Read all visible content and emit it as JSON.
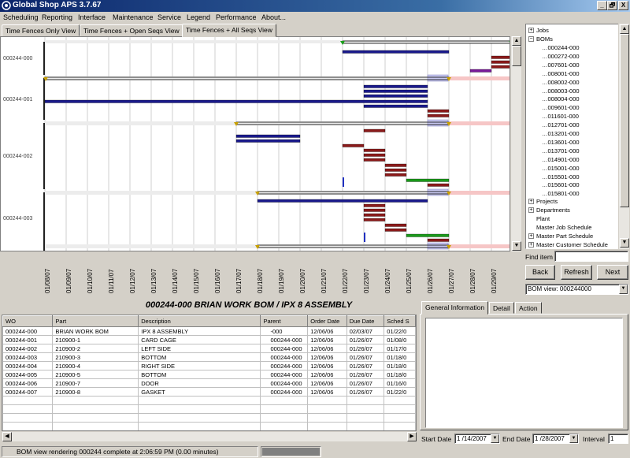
{
  "window": {
    "title": "Global Shop APS 3.7.67",
    "controls": [
      "_",
      "🗗",
      "X"
    ]
  },
  "menu": [
    "Scheduling",
    "Reporting",
    "Interface",
    "Maintenance",
    "Service",
    "Legend",
    "Performance",
    "About..."
  ],
  "tabs": [
    "Time Fences Only View",
    "Time Fences + Open Seqs View",
    "Time Fences + All Seqs View"
  ],
  "gantt": {
    "rows": [
      "000244-000",
      "000244-001",
      "000244-002",
      "000244-003"
    ],
    "dates": [
      "01/08/07",
      "01/09/07",
      "01/10/07",
      "01/11/07",
      "01/12/07",
      "01/13/07",
      "01/14/07",
      "01/15/07",
      "01/16/07",
      "01/17/07",
      "01/18/07",
      "01/19/07",
      "01/20/07",
      "01/21/07",
      "01/22/07",
      "01/23/07",
      "01/24/07",
      "01/25/07",
      "01/26/07",
      "01/27/07",
      "01/28/07",
      "01/29/07"
    ]
  },
  "tree": {
    "jobs": "Jobs",
    "boms": "BOMs",
    "bom_items": [
      "000244-000",
      "000272-000",
      "007601-000",
      "008001-000",
      "008002-000",
      "008003-000",
      "008004-000",
      "009601-000",
      "011601-000",
      "012701-000",
      "013201-000",
      "013601-000",
      "013701-000",
      "014901-000",
      "015001-000",
      "015501-000",
      "015601-000",
      "015801-000"
    ],
    "other": [
      "Projects",
      "Departments",
      "Plant",
      "Master Job Schedule",
      "Master Part Schedule",
      "Master Customer Schedule"
    ]
  },
  "find": {
    "label": "Find item",
    "value": ""
  },
  "buttons": {
    "back": "Back",
    "refresh": "Refresh",
    "next": "Next"
  },
  "bom_view": "BOM view: 000244000",
  "wo_heading": "000244-000   BRIAN WORK BOM / IPX 8 ASSEMBLY",
  "table": {
    "columns": [
      "WO",
      "Part",
      "Description",
      "Parent",
      "Order Date",
      "Due Date",
      "Sched S"
    ],
    "rows": [
      [
        "000244-000",
        "BRIAN WORK BOM",
        "IPX 8 ASSEMBLY",
        "-000",
        "12/06/06",
        "02/03/07",
        "01/22/0"
      ],
      [
        "000244-001",
        "210900-1",
        "CARD CAGE",
        "000244-000",
        "12/06/06",
        "01/26/07",
        "01/08/0"
      ],
      [
        "000244-002",
        "210900-2",
        "LEFT SIDE",
        "000244-000",
        "12/06/06",
        "01/26/07",
        "01/17/0"
      ],
      [
        "000244-003",
        "210900-3",
        "BOTTOM",
        "000244-000",
        "12/06/06",
        "01/26/07",
        "01/18/0"
      ],
      [
        "000244-004",
        "210900-4",
        "RIGHT SIDE",
        "000244-000",
        "12/06/06",
        "01/26/07",
        "01/18/0"
      ],
      [
        "000244-005",
        "210900-5",
        "BOTTOM",
        "000244-000",
        "12/06/06",
        "01/26/07",
        "01/18/0"
      ],
      [
        "000244-006",
        "210900-7",
        "DOOR",
        "000244-000",
        "12/06/06",
        "01/26/07",
        "01/16/0"
      ],
      [
        "000244-007",
        "210900-8",
        "GASKET",
        "000244-000",
        "12/06/06",
        "01/26/07",
        "01/22/0"
      ]
    ]
  },
  "detail_tabs": [
    "General Information",
    "Detail",
    "Action"
  ],
  "dates": {
    "start_label": "Start Date",
    "start": "1 /14/2007",
    "end_label": "End Date",
    "end": "1 /28/2007",
    "interval_label": "Interval",
    "interval": "1"
  },
  "status": "BOM view rendering 000244 complete at 2:06:59 PM  (0.00 minutes)",
  "colors": {
    "blue_bar": "#1a1a8c",
    "red_bar": "#8b1a1a",
    "green_bar": "#1a9a1a",
    "purple_bar": "#7a1a9a",
    "title_dark": "#0a246a"
  }
}
